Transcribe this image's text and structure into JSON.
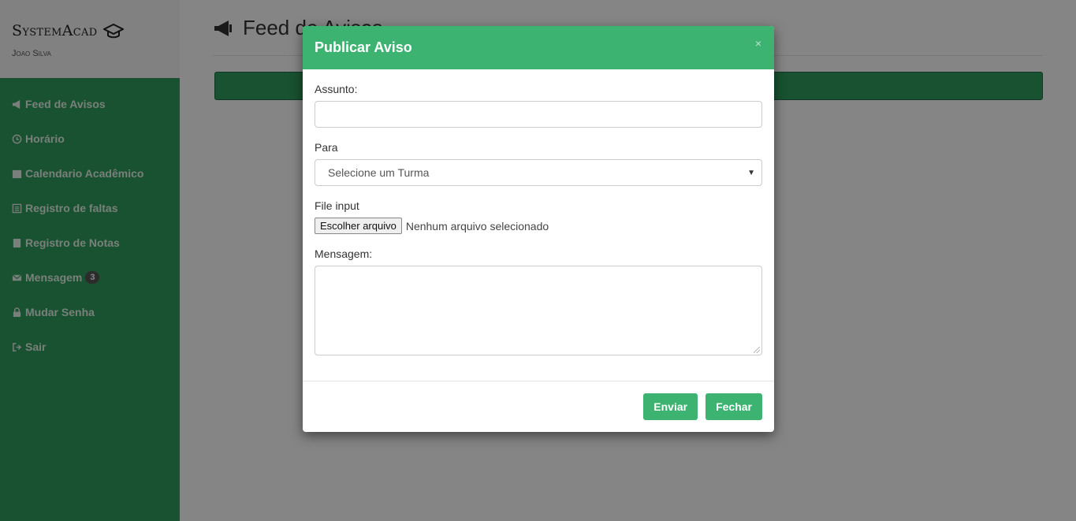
{
  "sidebar": {
    "brand": "SystemAcad",
    "user": "Joao Silva",
    "items": [
      {
        "label": "Feed de Avisos",
        "icon": "megaphone-icon"
      },
      {
        "label": "Horário",
        "icon": "clock-icon"
      },
      {
        "label": "Calendario Acadêmico",
        "icon": "calendar-icon"
      },
      {
        "label": "Registro de faltas",
        "icon": "list-icon"
      },
      {
        "label": "Registro de Notas",
        "icon": "book-icon"
      },
      {
        "label": "Mensagem",
        "icon": "envelope-icon",
        "badge": "3"
      },
      {
        "label": "Mudar Senha",
        "icon": "lock-icon"
      },
      {
        "label": "Sair",
        "icon": "logout-icon"
      }
    ]
  },
  "main": {
    "title": "Feed de Avisos"
  },
  "modal": {
    "title": "Publicar Aviso",
    "close": "×",
    "subject_label": "Assunto:",
    "subject_value": "",
    "to_label": "Para",
    "to_selected": "Selecione um Turma",
    "file_label": "File input",
    "file_button": "Escolher arquivo",
    "file_status": "Nenhum arquivo selecionado",
    "message_label": "Mensagem:",
    "send_button": "Enviar",
    "close_button": "Fechar"
  },
  "colors": {
    "sidebar": "#2f9d5d",
    "modal_header": "#3cb371",
    "button": "#3cb371"
  }
}
